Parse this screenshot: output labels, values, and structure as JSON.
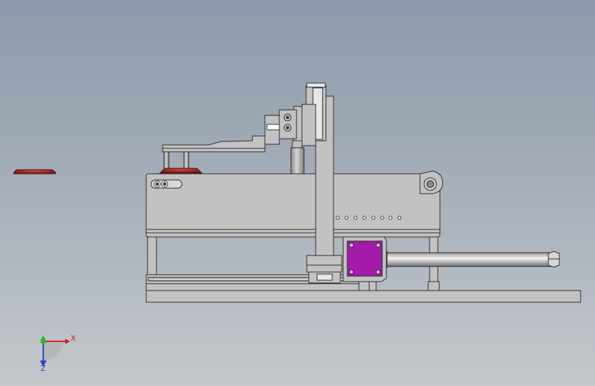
{
  "viewport": {
    "background_top": "#8d9aab",
    "background_bottom": "#c4c8cc"
  },
  "triad": {
    "x_label": "X",
    "z_label": "Z",
    "x_color": "#d42020",
    "y_color": "#2fb52f",
    "z_color": "#2a45c8"
  },
  "colors": {
    "part_gray": "#c2c2c2",
    "part_edge": "#2a2a2a",
    "motor_magenta": "#a31ba8",
    "red_part": "#b01818",
    "rod_light": "#f2f2f2",
    "rod_dark": "#7b7b7b"
  }
}
